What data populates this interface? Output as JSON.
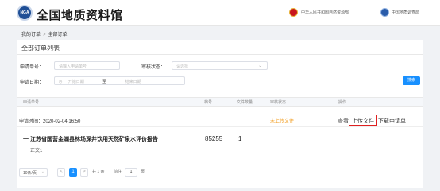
{
  "header": {
    "logo_text": "NGA",
    "site_title": "全国地质资料馆",
    "ministry_text": "中华人民共和国自然资源部",
    "cgs_text": "中国地质调查局"
  },
  "breadcrumb": {
    "parent": "我的订单",
    "separator": ">",
    "current": "全部订单"
  },
  "card": {
    "title": "全部订单列表"
  },
  "filters": {
    "order_no_label": "申请单号：",
    "order_no_placeholder": "请输入申请单号",
    "status_label": "审核状态：",
    "status_placeholder": "请选择",
    "date_label": "申请日期：",
    "start_placeholder": "开始日期",
    "range_sep": "至",
    "end_placeholder": "结束日期",
    "search_button": "搜索"
  },
  "table": {
    "columns": [
      "申请单号",
      "档号",
      "文件数量",
      "审核状态",
      "操作"
    ]
  },
  "order": {
    "time_label": "申请时间：",
    "time_value": "2020-02-04 16:50",
    "status": "未上传文件",
    "actions": {
      "view": "查看",
      "upload": "上传文件",
      "download": "下载申请单"
    },
    "item": {
      "title": "一 江苏省国营金湖县林场深井饮用天然矿泉水评价报告",
      "subtitle": "正文1",
      "archive_no": "85255",
      "file_count": "1"
    }
  },
  "pagination": {
    "page_size": "10条/页",
    "current_page": "1",
    "total_text": "共 1 条",
    "goto_label": "前往",
    "goto_value": "1",
    "page_unit": "页",
    "prev": "<",
    "next": ">"
  },
  "colors": {
    "primary": "#1890ff",
    "pending": "#f29b1b",
    "highlight_box": "#e02020"
  }
}
